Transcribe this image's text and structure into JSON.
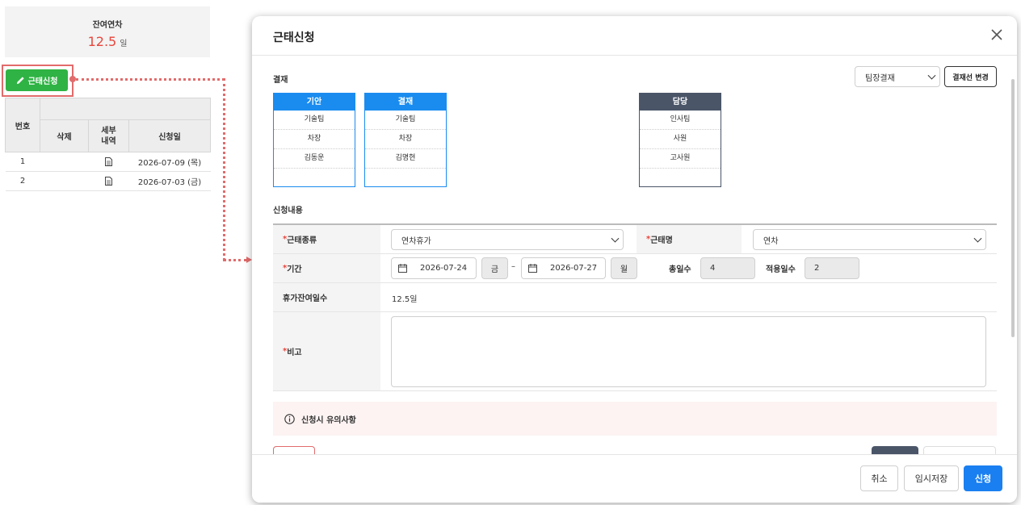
{
  "left": {
    "remaining_label": "잔여연차",
    "remaining_value": "12.5",
    "remaining_unit": "일",
    "apply_button": "근태신청",
    "table": {
      "col_no": "번호",
      "col_delete": "삭제",
      "col_detail": "세부\n내역",
      "col_date": "신청일",
      "rows": [
        {
          "no": "1",
          "date": "2026-07-09 (목)"
        },
        {
          "no": "2",
          "date": "2026-07-03 (금)"
        }
      ]
    }
  },
  "modal": {
    "title": "근태신청",
    "approval_section": "결재",
    "approval_line_select": "팀장결재",
    "change_approval_button": "결재선 변경",
    "boxes": [
      {
        "header": "기안",
        "dept": "기술팀",
        "position": "차장",
        "name": "김동운"
      },
      {
        "header": "결재",
        "dept": "기술팀",
        "position": "차장",
        "name": "김명현"
      },
      {
        "header": "담당",
        "dept": "인사팀",
        "position": "사원",
        "name": "고사원"
      }
    ],
    "content_section": "신청내용",
    "form": {
      "type_label": "근태종류",
      "type_value": "연차휴가",
      "name_label": "근태명",
      "name_value": "연차",
      "period_label": "기간",
      "start_date": "2026-07-24",
      "start_day": "금",
      "dash": "–",
      "end_date": "2026-07-27",
      "end_day": "월",
      "total_days_label": "총일수",
      "total_days_value": "4",
      "applied_days_label": "적용일수",
      "applied_days_value": "2",
      "remaining_label": "휴가잔여일수",
      "remaining_value": "12.5일",
      "remark_label": "비고",
      "required_mark": "*"
    },
    "notice": "신청시 유의사항",
    "buttons": {
      "cancel": "취소",
      "save_draft": "임시저장",
      "submit": "신청"
    }
  },
  "colors": {
    "accent_blue": "#1a7ff0",
    "green": "#2fb344",
    "red": "#e8453c",
    "dark_header": "#4a5568"
  }
}
